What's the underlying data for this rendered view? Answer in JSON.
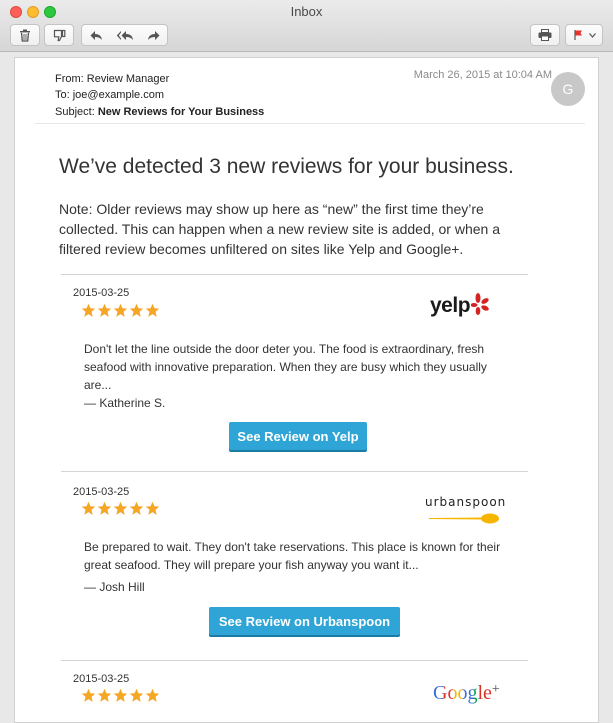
{
  "window": {
    "title": "Inbox"
  },
  "toolbar": {
    "delete_icon": "trash-icon",
    "junk_icon": "thumbs-down-icon",
    "reply_icon": "reply-icon",
    "reply_all_icon": "reply-all-icon",
    "forward_icon": "forward-icon",
    "print_icon": "printer-icon",
    "flag_icon": "flag-icon",
    "flag_color": "#e8322f"
  },
  "email": {
    "from": "From: Review Manager",
    "to": "To: joe@example.com",
    "subject_label": "Subject: ",
    "subject": "New Reviews for Your Business",
    "date": "March 26, 2015 at 10:04 AM",
    "avatar_initial": "G",
    "headline": "We’ve detected 3 new reviews for your business.",
    "note": "Note: Older reviews may show up here as “new” the first time they’re collected. This can happen when a new review site is added, or when a filtered review becomes unfiltered on sites like Yelp and Google+."
  },
  "reviews": [
    {
      "date": "2015-03-25",
      "rating": 5,
      "site": "yelp",
      "logo_text": "yelp",
      "body": "Don't let the line outside the door deter you. The food is extraordinary, fresh seafood with innovative preparation. When they are busy which they usually are...",
      "author": "— Katherine S.",
      "button": "See Review on Yelp"
    },
    {
      "date": "2015-03-25",
      "rating": 5,
      "site": "urbanspoon",
      "logo_text": "urbanspoon",
      "body": "Be prepared to wait. They don't take reservations. This place is known for their great seafood. They will prepare your fish anyway you want it...",
      "author": "— Josh Hill",
      "button": "See Review on Urbanspoon"
    },
    {
      "date": "2015-03-25",
      "rating": 5,
      "site": "google",
      "logo_text": "Google",
      "logo_plus": "+"
    }
  ],
  "colors": {
    "button": "#2ea5d6",
    "star": "#f5a623",
    "yelp_red": "#d32323",
    "urbanspoon_yellow": "#f7b500"
  }
}
